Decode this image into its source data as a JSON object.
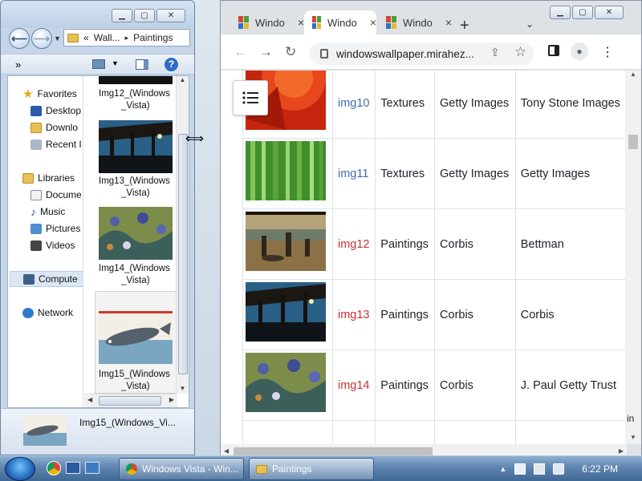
{
  "explorer": {
    "breadcrumb_prefix": "«",
    "breadcrumb": [
      "Wall...",
      "Paintings"
    ],
    "toolbar_overflow": "»",
    "nav": [
      {
        "label": "Favorites"
      },
      {
        "label": "Desktop"
      },
      {
        "label": "Downlo"
      },
      {
        "label": "Recent I"
      },
      {
        "label": "Libraries"
      },
      {
        "label": "Docume"
      },
      {
        "label": "Music"
      },
      {
        "label": "Pictures"
      },
      {
        "label": "Videos"
      },
      {
        "label": "Compute"
      },
      {
        "label": "Network"
      }
    ],
    "files": [
      {
        "line1": "Img12_(Windows",
        "line2": "_Vista)"
      },
      {
        "line1": "Img13_(Windows",
        "line2": "_Vista)"
      },
      {
        "line1": "Img14_(Windows",
        "line2": "_Vista)"
      },
      {
        "line1": "Img15_(Windows",
        "line2": "_Vista)"
      }
    ],
    "details_filename": "Img15_(Windows_Vi..."
  },
  "browser": {
    "tabs": [
      {
        "title": "Windo",
        "close": "×"
      },
      {
        "title": "Windo",
        "close": "×"
      },
      {
        "title": "Windo",
        "close": "×"
      }
    ],
    "new_tab": "+",
    "tab_search": "⌄",
    "url": "windowswallpaper.mirahez...",
    "table": [
      {
        "name": "img10",
        "category": "Textures",
        "source": "Getty Images",
        "photographer": "Tony Stone Images",
        "link_color": "#3d6fb0"
      },
      {
        "name": "img11",
        "category": "Textures",
        "source": "Getty Images",
        "photographer": "Getty Images",
        "link_color": "#3d6fb0"
      },
      {
        "name": "img12",
        "category": "Paintings",
        "source": "Corbis",
        "photographer": "Bettman",
        "link_color": "#c8323a"
      },
      {
        "name": "img13",
        "category": "Paintings",
        "source": "Corbis",
        "photographer": "Corbis",
        "link_color": "#c8323a"
      },
      {
        "name": "img14",
        "category": "Paintings",
        "source": "Corbis",
        "photographer": "J. Paul Getty Trust",
        "link_color": "#c8323a"
      }
    ],
    "edge_fragment": "in"
  },
  "taskbar": {
    "tasks": [
      {
        "label": "Windows Vista - Win..."
      },
      {
        "label": "Paintings"
      }
    ],
    "clock": "6:22 PM"
  },
  "colors": {
    "link_blue": "#3d6fb0",
    "link_red": "#c8323a",
    "taskbar": "#4f77a3"
  }
}
